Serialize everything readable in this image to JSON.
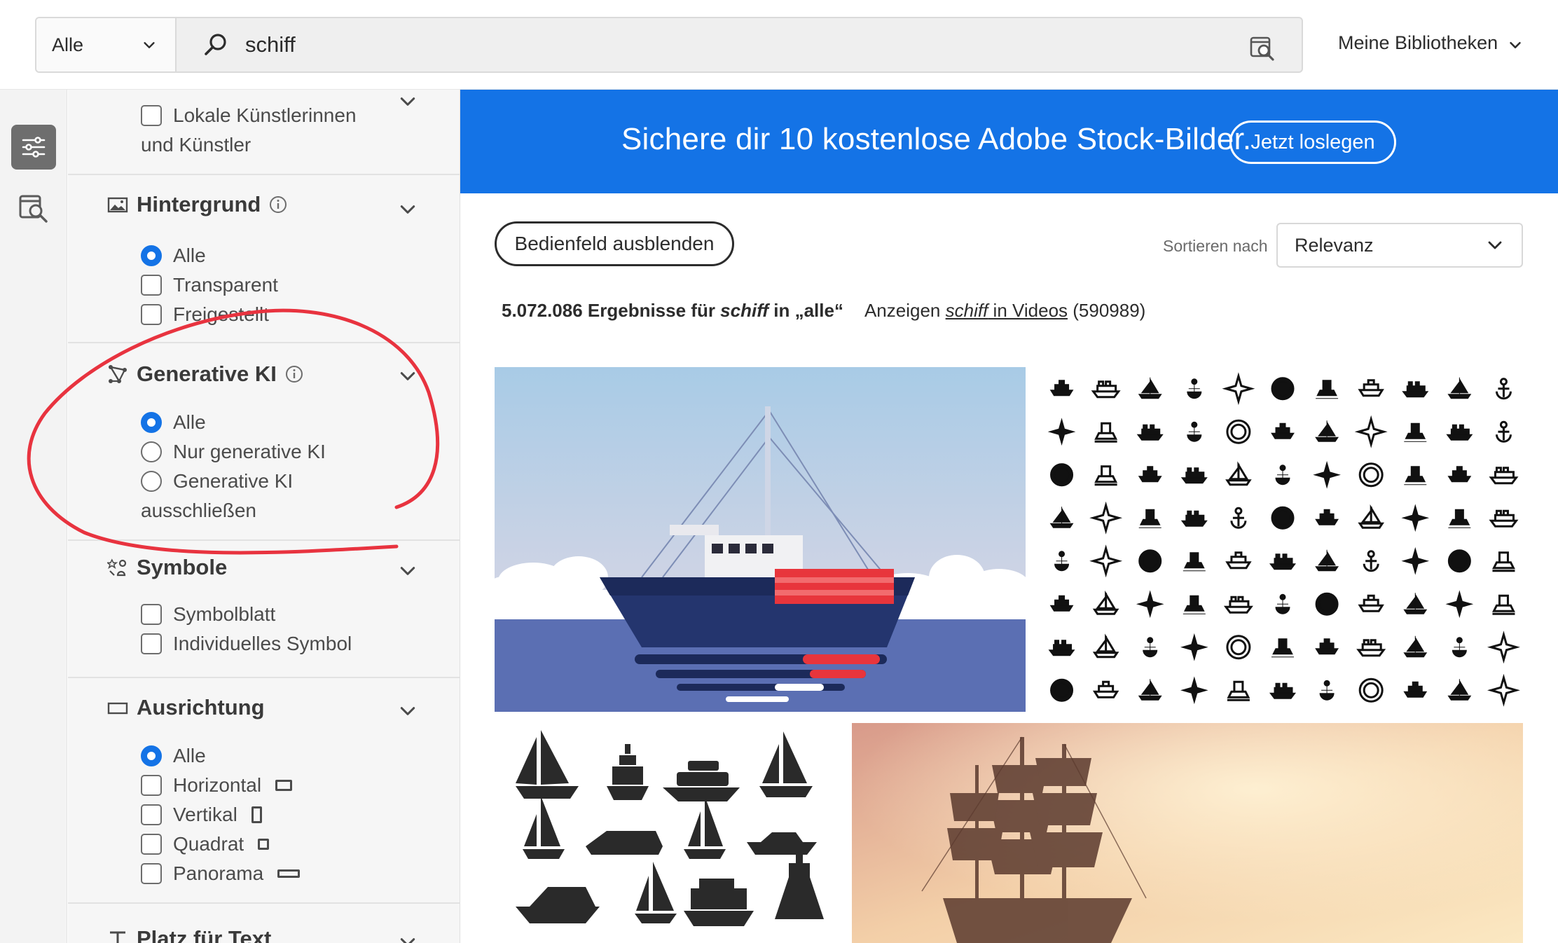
{
  "search": {
    "scope_value": "Alle",
    "query": "schiff",
    "my_libraries": "Meine Bibliotheken"
  },
  "filters": {
    "artists": {
      "label_line1": "Lokale Künstlerinnen",
      "label_line2": "und Künstler"
    },
    "background": {
      "title": "Hintergrund",
      "options": [
        "Alle",
        "Transparent",
        "Freigestellt"
      ]
    },
    "generative_ai": {
      "title": "Generative KI",
      "options": [
        "Alle",
        "Nur generative KI",
        "Generative KI"
      ],
      "option3_line2": "ausschließen"
    },
    "symbols": {
      "title": "Symbole",
      "options": [
        "Symbolblatt",
        "Individuelles Symbol"
      ]
    },
    "orientation": {
      "title": "Ausrichtung",
      "options": [
        "Alle",
        "Horizontal",
        "Vertikal",
        "Quadrat",
        "Panorama"
      ]
    },
    "copy_space": {
      "title": "Platz für Text"
    }
  },
  "banner": {
    "message": "Sichere dir 10 kostenlose Adobe Stock-Bilder.",
    "cta": "Jetzt loslegen"
  },
  "results": {
    "hide_panel": "Bedienfeld ausblenden",
    "sort_label": "Sortieren nach",
    "sort_value": "Relevanz",
    "count_prefix": "5.072.086 Ergebnisse für ",
    "count_query": "schiff",
    "count_suffix": " in „alle“",
    "videos_prefix": "Anzeigen ",
    "videos_link_query": "schiff",
    "videos_link_suffix": " in Videos",
    "videos_count": " (590989)"
  },
  "colors": {
    "accent_blue": "#1473e6",
    "annotation_red": "#e8333f"
  },
  "icons": {
    "filter": "sliders-icon",
    "visual_search": "image-search-icon",
    "search": "magnifier-icon",
    "chevron": "chevron-down-icon"
  }
}
